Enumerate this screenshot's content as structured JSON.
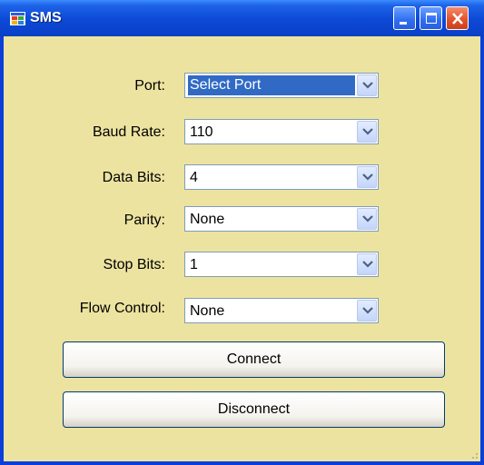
{
  "window": {
    "title": "SMS",
    "icon": "app-window-icon",
    "controls": [
      "minimize-icon",
      "maximize-icon",
      "close-icon"
    ]
  },
  "form": {
    "port": {
      "label": "Port:",
      "value": "Select Port"
    },
    "baud_rate": {
      "label": "Baud Rate:",
      "value": "110"
    },
    "data_bits": {
      "label": "Data Bits:",
      "value": "4"
    },
    "parity": {
      "label": "Parity:",
      "value": "None"
    },
    "stop_bits": {
      "label": "Stop Bits:",
      "value": "1"
    },
    "flow_control": {
      "label": "Flow Control:",
      "value": "None"
    }
  },
  "buttons": {
    "connect": "Connect",
    "disconnect": "Disconnect"
  },
  "colors": {
    "client_background": "#ece3a0",
    "title_bar": "#0a3fd9",
    "selection": "#316ac5",
    "close_button": "#e0502a"
  }
}
